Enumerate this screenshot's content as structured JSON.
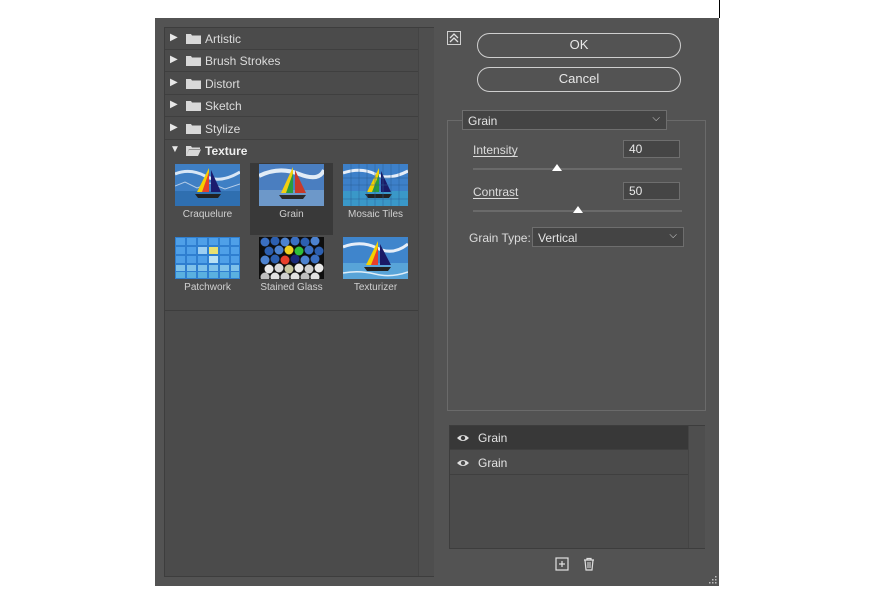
{
  "categories": [
    {
      "label": "Artistic",
      "expanded": false
    },
    {
      "label": "Brush Strokes",
      "expanded": false
    },
    {
      "label": "Distort",
      "expanded": false
    },
    {
      "label": "Sketch",
      "expanded": false
    },
    {
      "label": "Stylize",
      "expanded": false
    },
    {
      "label": "Texture",
      "expanded": true
    }
  ],
  "thumbnails": [
    {
      "label": "Craquelure"
    },
    {
      "label": "Grain",
      "selected": true
    },
    {
      "label": "Mosaic Tiles"
    },
    {
      "label": "Patchwork"
    },
    {
      "label": "Stained Glass"
    },
    {
      "label": "Texturizer"
    }
  ],
  "buttons": {
    "ok": "OK",
    "cancel": "Cancel"
  },
  "filter_select": {
    "value": "Grain"
  },
  "params": {
    "intensity": {
      "label": "Intensity",
      "value": "40",
      "slider_fraction": 0.4
    },
    "contrast": {
      "label": "Contrast",
      "value": "50",
      "slider_fraction": 0.5
    },
    "grain_type": {
      "label": "Grain Type:",
      "value": "Vertical"
    }
  },
  "layers": [
    {
      "label": "Grain",
      "active": true
    },
    {
      "label": "Grain",
      "active": false
    }
  ],
  "icons": {
    "collapse": "collapse-arrows-icon",
    "folder": "folder-icon",
    "eye": "eye-icon",
    "new_layer": "new-layer-icon",
    "delete": "trash-icon",
    "grip": "resize-grip-icon"
  }
}
